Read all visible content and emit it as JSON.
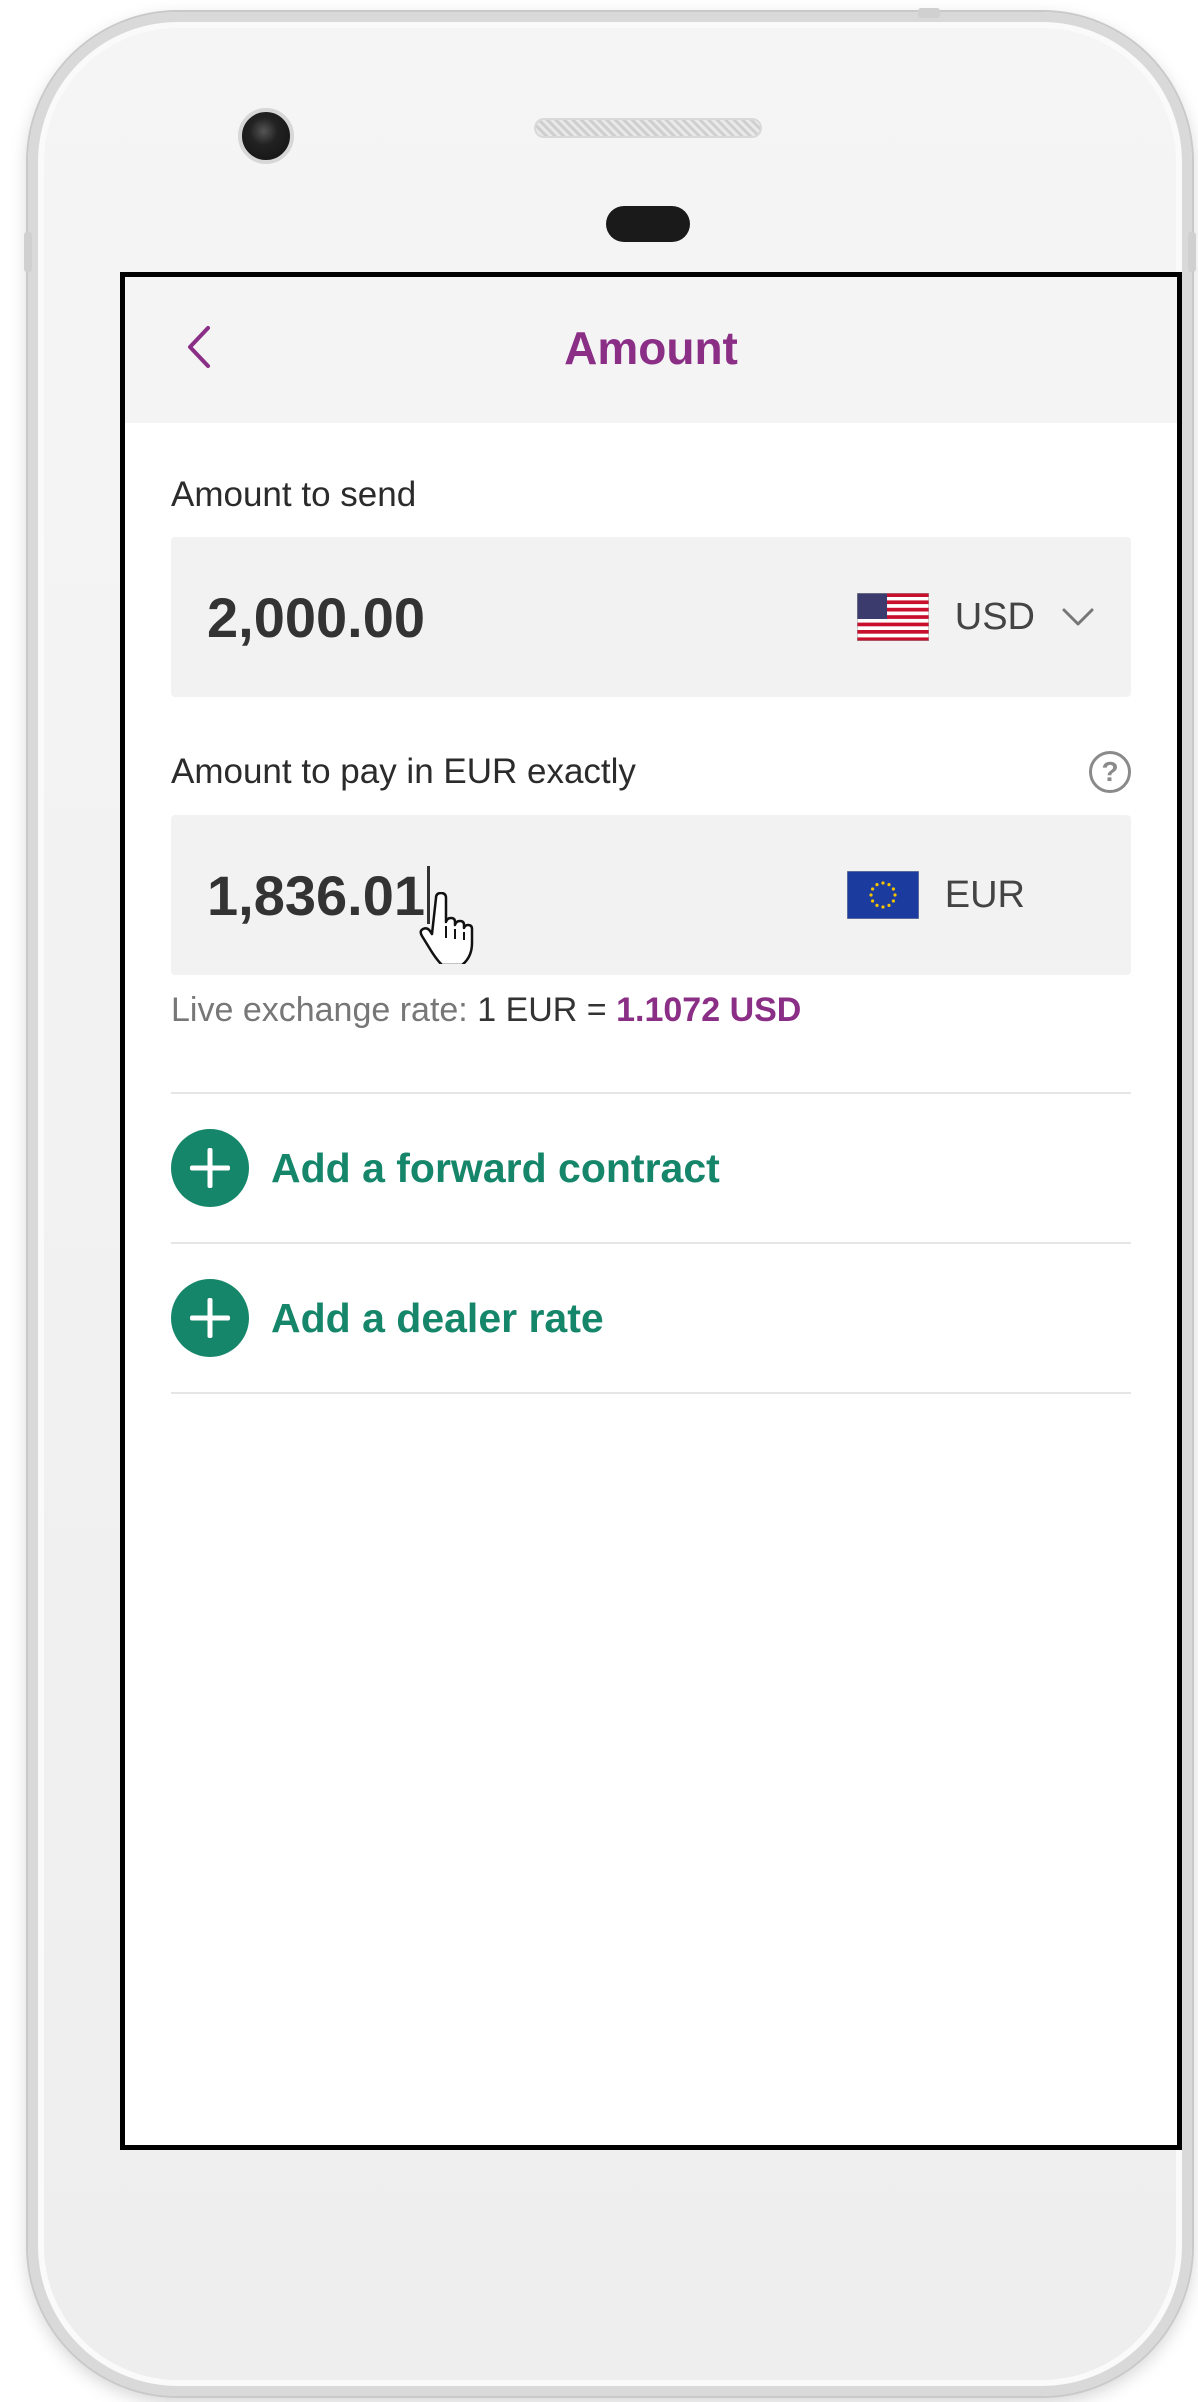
{
  "header": {
    "title": "Amount",
    "back_icon": "chevron-left-icon"
  },
  "send": {
    "label": "Amount to send",
    "value": "2,000.00",
    "currency": "USD",
    "flag_icon": "us-flag-icon",
    "dropdown_icon": "chevron-down-icon"
  },
  "pay": {
    "label": "Amount to pay in EUR exactly",
    "help_icon": "question-circle-icon",
    "help_glyph": "?",
    "value": "1,836.01",
    "currency": "EUR",
    "flag_icon": "eu-flag-icon"
  },
  "rate": {
    "prefix": "Live exchange rate:",
    "base": "1 EUR =",
    "quote": "1.1072 USD"
  },
  "actions": [
    {
      "label": "Add a forward contract",
      "icon": "plus-circle-icon"
    },
    {
      "label": "Add a dealer rate",
      "icon": "plus-circle-icon"
    }
  ],
  "colors": {
    "accent_purple": "#8a2e86",
    "accent_green": "#16866a",
    "field_bg": "#f2f2f3",
    "header_bg": "#f4f4f5"
  }
}
